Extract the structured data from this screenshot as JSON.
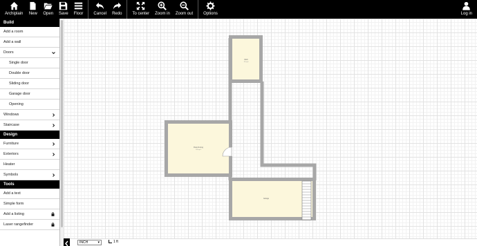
{
  "toolbar": {
    "archiplain": "Archiplain",
    "new": "New",
    "open": "Open",
    "save": "Save",
    "floor": "Floor",
    "cancel": "Cancel",
    "redo": "Redo",
    "to_center": "To center",
    "zoom_in": "Zoom in",
    "zoom_out": "Zoom out",
    "options": "Options",
    "login": "Log in"
  },
  "sidebar": {
    "build": {
      "header": "Build",
      "add_room": "Add a room",
      "add_wall": "Add a wall",
      "doors": "Doors",
      "single_door": "Single door",
      "double_door": "Double door",
      "sliding_door": "Sliding door",
      "garage_door": "Garage door",
      "opening": "Opening",
      "windows": "Windows",
      "staircase": "Staircase"
    },
    "design": {
      "header": "Design",
      "furniture": "Furniture",
      "exteriors": "Exteriors",
      "heater": "Heater",
      "symbols": "Symbols"
    },
    "tools": {
      "header": "Tools",
      "add_text": "Add a text",
      "simple_form": "Simple form",
      "add_listing": "Add a listing",
      "laser_rangefinder": "Laser rangefinder"
    }
  },
  "plan": {
    "room_top_name": "Kitch",
    "room_top_area": "29 sq ft",
    "room_left_name": "Room/Living",
    "room_left_area": "226 sq ft",
    "room_bottom_name": "Garage",
    "room_bottom_area": "—"
  },
  "bottom": {
    "unit": "INCH",
    "scale": "1 ft"
  },
  "colors": {
    "toolbar_bg": "#000000",
    "wall": "#a7a7a7",
    "room_fill": "#fcf7dc"
  }
}
